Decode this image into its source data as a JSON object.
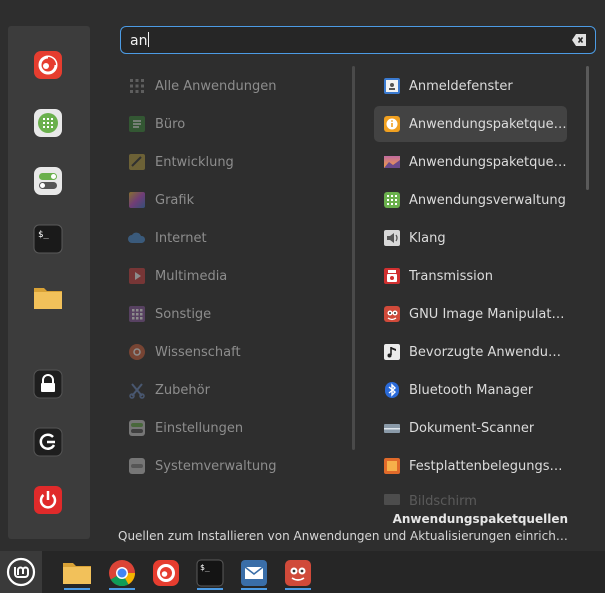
{
  "search": {
    "query": "an"
  },
  "favorites": [
    {
      "name": "firefox-icon"
    },
    {
      "name": "software-manager-icon"
    },
    {
      "name": "settings-toggle-icon"
    },
    {
      "name": "terminal-icon"
    },
    {
      "name": "folder-icon"
    },
    {
      "name": "lock-icon"
    },
    {
      "name": "logout-icon"
    },
    {
      "name": "power-icon"
    }
  ],
  "categories": [
    {
      "label": "Alle Anwendungen",
      "icon": "all-apps-icon",
      "color": "#9a9a9a"
    },
    {
      "label": "Büro",
      "icon": "office-icon",
      "color": "#3a8a3a"
    },
    {
      "label": "Entwicklung",
      "icon": "development-icon",
      "color": "#b8a040"
    },
    {
      "label": "Grafik",
      "icon": "graphics-icon",
      "color": "#c04fd0"
    },
    {
      "label": "Internet",
      "icon": "internet-icon",
      "color": "#4a90d9"
    },
    {
      "label": "Multimedia",
      "icon": "multimedia-icon",
      "color": "#d04040"
    },
    {
      "label": "Sonstige",
      "icon": "other-icon",
      "color": "#8a5aa0"
    },
    {
      "label": "Wissenschaft",
      "icon": "science-icon",
      "color": "#d0603a"
    },
    {
      "label": "Zubehör",
      "icon": "accessories-icon",
      "color": "#6a8ac0"
    },
    {
      "label": "Einstellungen",
      "icon": "preferences-icon",
      "color": "#8a8a8a"
    },
    {
      "label": "Systemverwaltung",
      "icon": "administration-icon",
      "color": "#8a8a8a"
    }
  ],
  "apps": [
    {
      "label": "Anmeldefenster",
      "icon": "login-window-icon",
      "color": "#3a7ad0"
    },
    {
      "label": "Anwendungspaketquellen",
      "icon": "info-icon",
      "color": "#f0a020"
    },
    {
      "label": "Anwendungspaketquellen",
      "icon": "wallpaper-icon",
      "color": "#d06a8a"
    },
    {
      "label": "Anwendungsverwaltung",
      "icon": "software-manager-icon",
      "color": "#6ab04c"
    },
    {
      "label": "Klang",
      "icon": "speaker-icon",
      "color": "#c8c8c8"
    },
    {
      "label": "Transmission",
      "icon": "transmission-icon",
      "color": "#d03030"
    },
    {
      "label": "GNU Image Manipulation Program",
      "icon": "gimp-icon",
      "color": "#d04a3a"
    },
    {
      "label": "Bevorzugte Anwendungen",
      "icon": "music-note-icon",
      "color": "#e8e8e8"
    },
    {
      "label": "Bluetooth Manager",
      "icon": "bluetooth-icon",
      "color": "#2a6ad8"
    },
    {
      "label": "Dokument-Scanner",
      "icon": "scanner-icon",
      "color": "#8a9aa8"
    },
    {
      "label": "Festplattenbelegungsanalyse",
      "icon": "disk-usage-icon",
      "color": "#e06a2a"
    },
    {
      "label": "Bildschirm",
      "icon": "display-icon",
      "color": "#8a8a8a"
    }
  ],
  "selected_app": {
    "title": "Anwendungspaketquellen",
    "description": "Quellen zum Installieren von Anwendungen und Aktualisierungen einrich…"
  },
  "taskbar": [
    {
      "name": "files",
      "icon": "folder-icon"
    },
    {
      "name": "chrome",
      "icon": "chrome-icon"
    },
    {
      "name": "firefox",
      "icon": "firefox-icon"
    },
    {
      "name": "terminal",
      "icon": "terminal-icon"
    },
    {
      "name": "mail",
      "icon": "mail-icon"
    },
    {
      "name": "gimp",
      "icon": "gimp-icon"
    }
  ],
  "colors": {
    "accent": "#4c9be4",
    "background": "#2e2e2e",
    "panel": "#3c3c3c"
  }
}
